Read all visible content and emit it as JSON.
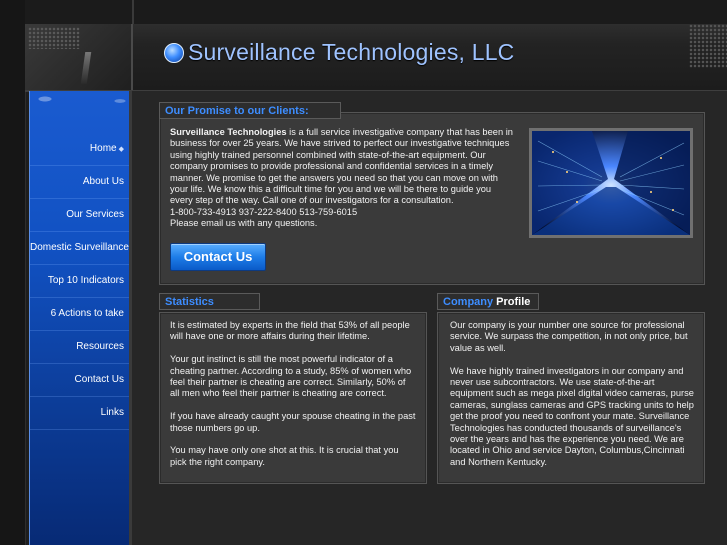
{
  "header": {
    "title": "Surveillance Technologies, LLC"
  },
  "sidebar": {
    "items": [
      {
        "label": "Home",
        "bullet": "◆"
      },
      {
        "label": "About Us"
      },
      {
        "label": "Our Services"
      },
      {
        "label": "Domestic Surveillance"
      },
      {
        "label": "Top 10 Indicators"
      },
      {
        "label": "6 Actions to take"
      },
      {
        "label": "Resources"
      },
      {
        "label": "Contact Us"
      },
      {
        "label": "Links"
      }
    ]
  },
  "promise": {
    "heading": "Our Promise to our Clients:",
    "company_name": "Surveillance Technologies",
    "body": " is a full service investigative company that has been in business for over 25 years.  We have strived to perfect our investigative techniques using highly trained personnel combined with state-of-the-art equipment.  Our company promises to provide professional and confidential services in a timely manner. We promise to get the answers you need so that you can move on with your life. We know this a difficult time for you and we will be there to guide you every step of the way. Call one of our investigators for a consultation.",
    "phones": "1-800-733-4913   937-222-8400   513-759-6015",
    "email_line": "Please email us with any questions.",
    "button_label": "Contact Us"
  },
  "statistics": {
    "heading": "Statistics",
    "paragraphs": [
      "It is estimated by experts in the field that 53% of all people will have one or more affairs during their lifetime.",
      "Your gut instinct is still the most powerful indicator of a cheating partner. According to a study, 85% of women who feel their partner is cheating are correct. Similarly, 50% of all men who feel their partner is cheating are correct.",
      "If you have already caught your spouse cheating in the past those numbers go up.",
      "You may have only one shot at this.  It is crucial that you pick the right company."
    ]
  },
  "profile": {
    "heading_part1": "Company",
    "heading_part2": " Profile",
    "paragraphs": [
      "Our company is your number one source for professional service. We surpass the competition, in not only price, but value as well.",
      "We have highly trained investigators in our company and never use subcontractors. We use state-of-the-art equipment such as mega pixel digital video cameras, purse cameras, sunglass cameras and GPS tracking units to help get the proof you need to confront your mate. Surveillance Technologies has conducted thousands of surveillance's over the years and has the experience you need. We are located in Ohio and service  Dayton, Columbus,Cincinnati and Northern Kentucky."
    ]
  },
  "colors": {
    "accent": "#3d8dff",
    "title": "#9fc3ff",
    "sidebar": "#1151c2"
  }
}
